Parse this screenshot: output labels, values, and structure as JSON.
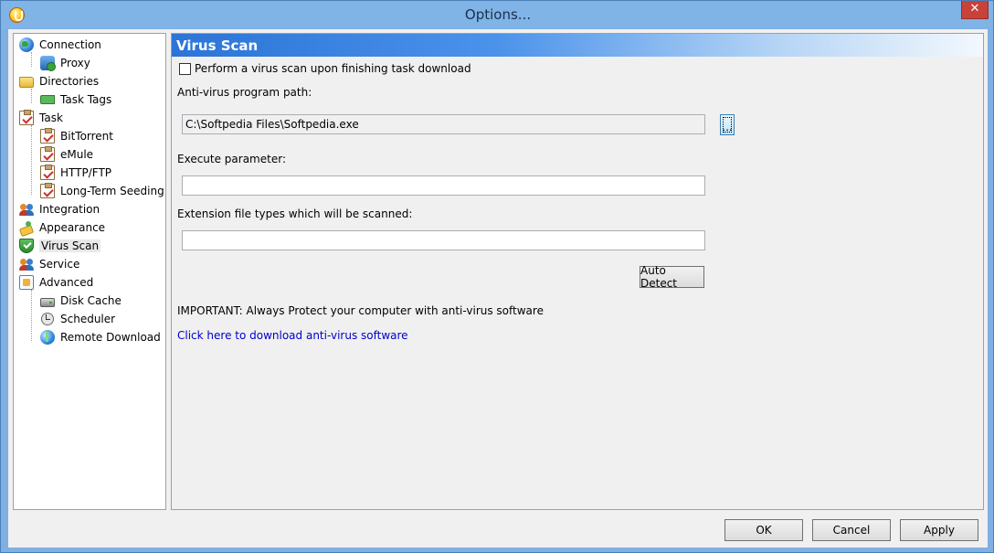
{
  "window": {
    "title": "Options...",
    "close_glyph": "✕"
  },
  "tree": {
    "items": [
      {
        "label": "Connection",
        "icon": "globe-icon",
        "level": 0
      },
      {
        "label": "Proxy",
        "icon": "network-icon",
        "level": 1
      },
      {
        "label": "Directories",
        "icon": "folder-icon",
        "level": 0
      },
      {
        "label": "Task Tags",
        "icon": "tag-icon",
        "level": 1
      },
      {
        "label": "Task",
        "icon": "clipboard-icon",
        "level": 0
      },
      {
        "label": "BitTorrent",
        "icon": "clipboard-icon",
        "level": 1
      },
      {
        "label": "eMule",
        "icon": "clipboard-icon",
        "level": 1
      },
      {
        "label": "HTTP/FTP",
        "icon": "clipboard-icon",
        "level": 1
      },
      {
        "label": "Long-Term Seeding",
        "icon": "clipboard-icon",
        "level": 1
      },
      {
        "label": "Integration",
        "icon": "people-icon",
        "level": 0
      },
      {
        "label": "Appearance",
        "icon": "appearance-icon",
        "level": 0
      },
      {
        "label": "Virus Scan",
        "icon": "shield-icon",
        "level": 0,
        "selected": true
      },
      {
        "label": "Service",
        "icon": "people-icon",
        "level": 0
      },
      {
        "label": "Advanced",
        "icon": "advanced-icon",
        "level": 0
      },
      {
        "label": "Disk Cache",
        "icon": "disk-icon",
        "level": 1
      },
      {
        "label": "Scheduler",
        "icon": "clock-icon",
        "level": 1
      },
      {
        "label": "Remote Download",
        "icon": "remote-globe-icon",
        "level": 1
      }
    ]
  },
  "panel": {
    "title": "Virus Scan",
    "scan_checkbox_label": "Perform a virus scan upon finishing task download",
    "scan_checked": false,
    "path_label": "Anti-virus program path:",
    "path_value": "C:\\Softpedia Files\\Softpedia.exe",
    "browse_label": "...",
    "param_label": "Execute parameter:",
    "param_value": "",
    "ext_label": "Extension file types which will be scanned:",
    "ext_value": "",
    "auto_detect_label": "Auto Detect",
    "important_text": "IMPORTANT: Always Protect your computer with anti-virus software",
    "download_link": "Click here to download anti-virus software"
  },
  "footer": {
    "ok_label": "OK",
    "cancel_label": "Cancel",
    "apply_label": "Apply"
  },
  "colors": {
    "title_bar": "#80b3e6",
    "header_gradient_start": "#2c74d6",
    "link": "#0000cc"
  }
}
